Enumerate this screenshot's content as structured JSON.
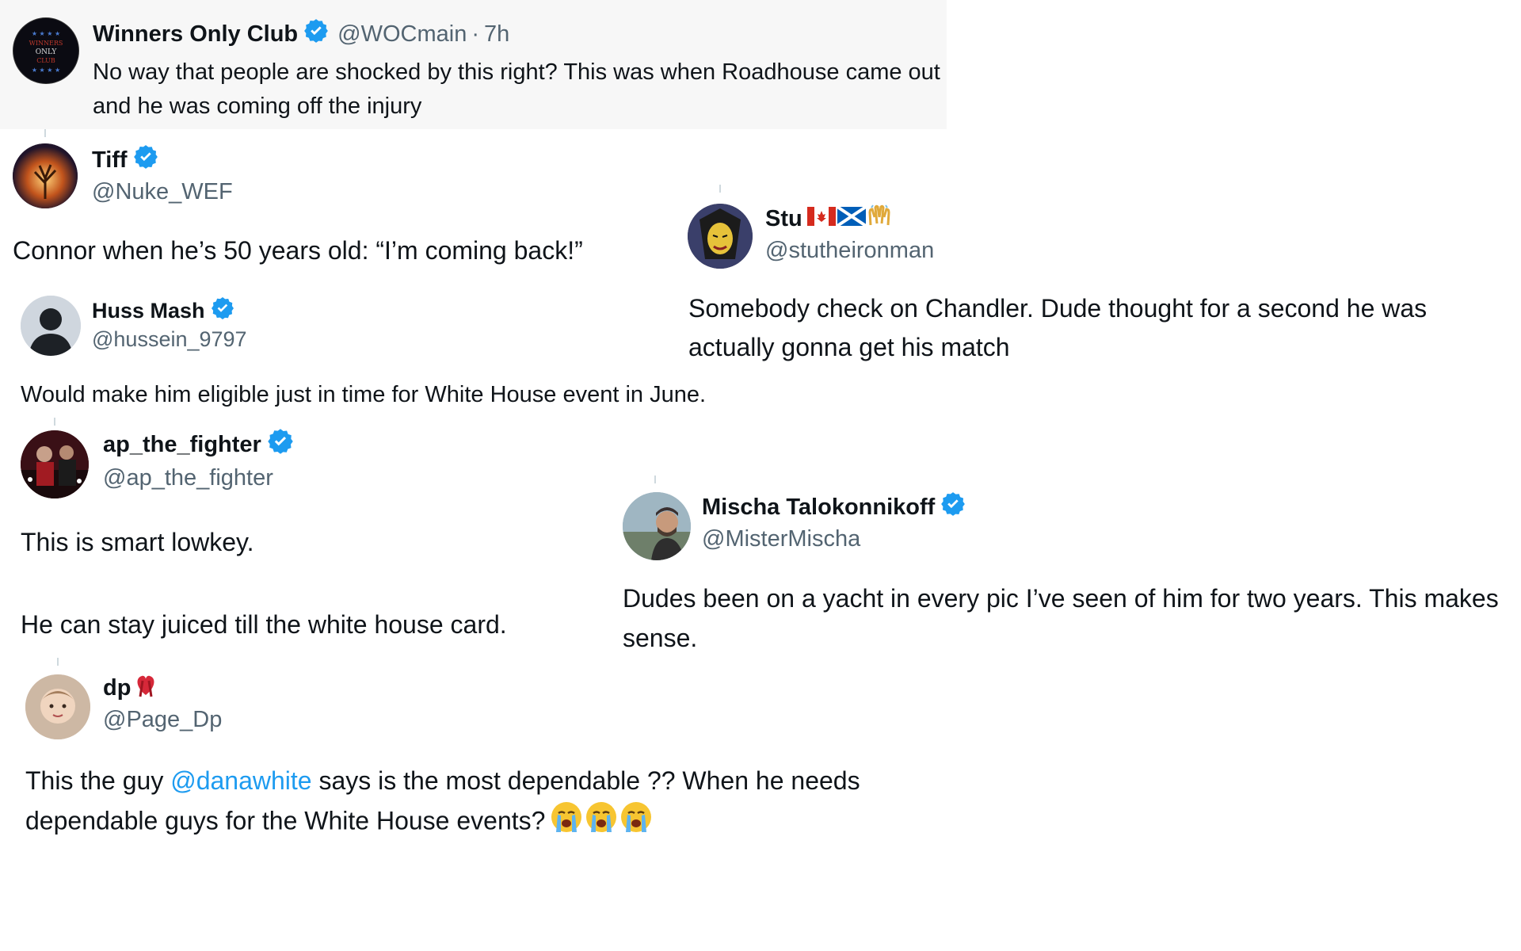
{
  "colors": {
    "verified": "#1d9bf0",
    "text_primary": "#0f1419",
    "text_secondary": "#536471",
    "link": "#1d9bf0",
    "highlight_bg": "#f7f7f7"
  },
  "tweets": [
    {
      "display_name": "Winners Only Club",
      "handle": "@WOCmain",
      "separator": "·",
      "time": "7h",
      "verified": true,
      "avatar_icon": "winners-only-club-logo",
      "avatar_text": "WINNERS ONLY CLUB",
      "text": "No way that people are shocked by this right? This was when Roadhouse came out and he was coming off the injury"
    },
    {
      "display_name": "Tiff",
      "handle": "@Nuke_WEF",
      "verified": true,
      "avatar_icon": "glowing-tree-avatar",
      "text": "Connor when he’s 50 years old: “I’m coming back!”"
    },
    {
      "display_name": "Stu",
      "handle": "@stutheironman",
      "verified": false,
      "name_emojis": [
        "canada-flag-icon",
        "scotland-flag-icon",
        "raising-hands-icon"
      ],
      "avatar_icon": "illustrated-face-avatar",
      "text": "Somebody check on Chandler. Dude thought for a second he was actually gonna get his match"
    },
    {
      "display_name": "Huss Mash",
      "handle": "@hussein_9797",
      "verified": true,
      "avatar_icon": "person-silhouette-avatar",
      "text": "Would make him eligible just in time for White House event in June."
    },
    {
      "display_name": "ap_the_fighter",
      "handle": "@ap_the_fighter",
      "verified": true,
      "avatar_icon": "fighter-photo-avatar",
      "text_line1": "This is smart lowkey.",
      "text_line2": "He can stay juiced till the white house card."
    },
    {
      "display_name": "Mischa Talokonnikoff",
      "handle": "@MisterMischa",
      "verified": true,
      "avatar_icon": "man-outdoors-avatar",
      "text": "Dudes been on a yacht in every pic I’ve seen of him for two years. This makes sense."
    },
    {
      "display_name": "dp",
      "handle": "@Page_Dp",
      "verified": false,
      "name_emojis": [
        "red-ribbon-heart-icon"
      ],
      "avatar_icon": "child-photo-avatar",
      "text_before": "This the guy ",
      "mention": "@danawhite",
      "text_after": " says is the most dependable ?? When he needs dependable guys for the White House events?",
      "trailing_emojis": [
        "loudly-crying-face-icon",
        "loudly-crying-face-icon",
        "loudly-crying-face-icon"
      ]
    }
  ]
}
